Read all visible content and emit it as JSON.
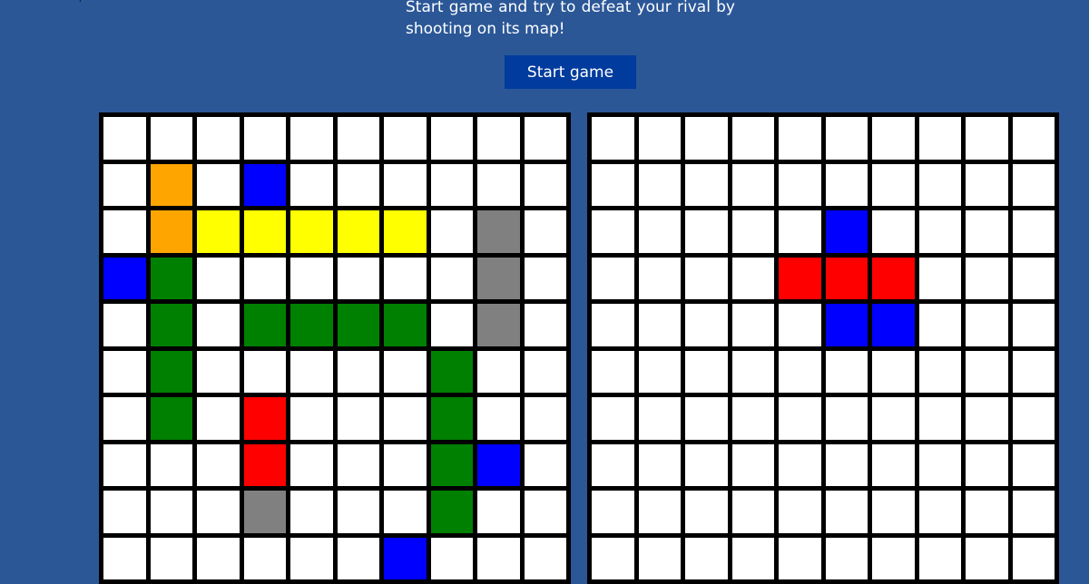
{
  "intro": {
    "text": "Start game and try to defeat your rival by shooting on its map!"
  },
  "start_button": {
    "label": "Start game"
  },
  "colors": {
    "page_background": "#2b5797",
    "button_background": "#003b9d",
    "grid_line": "#000000",
    "empty": "#ffffff",
    "orange": "#ffa500",
    "blue": "#0000ff",
    "yellow": "#ffff00",
    "gray": "#808080",
    "green": "#008000",
    "red": "#ff0000"
  },
  "boards": {
    "player": {
      "size": 10,
      "cells": [
        [
          "empty",
          "empty",
          "empty",
          "empty",
          "empty",
          "empty",
          "empty",
          "empty",
          "empty",
          "empty"
        ],
        [
          "empty",
          "orange",
          "empty",
          "blue",
          "empty",
          "empty",
          "empty",
          "empty",
          "empty",
          "empty"
        ],
        [
          "empty",
          "orange",
          "yellow",
          "yellow",
          "yellow",
          "yellow",
          "yellow",
          "empty",
          "gray",
          "empty"
        ],
        [
          "blue",
          "green",
          "empty",
          "empty",
          "empty",
          "empty",
          "empty",
          "empty",
          "gray",
          "empty"
        ],
        [
          "empty",
          "green",
          "empty",
          "green",
          "green",
          "green",
          "green",
          "empty",
          "gray",
          "empty"
        ],
        [
          "empty",
          "green",
          "empty",
          "empty",
          "empty",
          "empty",
          "empty",
          "green",
          "empty",
          "empty"
        ],
        [
          "empty",
          "green",
          "empty",
          "red",
          "empty",
          "empty",
          "empty",
          "green",
          "empty",
          "empty"
        ],
        [
          "empty",
          "empty",
          "empty",
          "red",
          "empty",
          "empty",
          "empty",
          "green",
          "blue",
          "empty"
        ],
        [
          "empty",
          "empty",
          "empty",
          "gray",
          "empty",
          "empty",
          "empty",
          "green",
          "empty",
          "empty"
        ],
        [
          "empty",
          "empty",
          "empty",
          "empty",
          "empty",
          "empty",
          "blue",
          "empty",
          "empty",
          "empty"
        ]
      ]
    },
    "rival": {
      "size": 10,
      "cells": [
        [
          "empty",
          "empty",
          "empty",
          "empty",
          "empty",
          "empty",
          "empty",
          "empty",
          "empty",
          "empty"
        ],
        [
          "empty",
          "empty",
          "empty",
          "empty",
          "empty",
          "empty",
          "empty",
          "empty",
          "empty",
          "empty"
        ],
        [
          "empty",
          "empty",
          "empty",
          "empty",
          "empty",
          "blue",
          "empty",
          "empty",
          "empty",
          "empty"
        ],
        [
          "empty",
          "empty",
          "empty",
          "empty",
          "red",
          "red",
          "red",
          "empty",
          "empty",
          "empty"
        ],
        [
          "empty",
          "empty",
          "empty",
          "empty",
          "empty",
          "blue",
          "blue",
          "empty",
          "empty",
          "empty"
        ],
        [
          "empty",
          "empty",
          "empty",
          "empty",
          "empty",
          "empty",
          "empty",
          "empty",
          "empty",
          "empty"
        ],
        [
          "empty",
          "empty",
          "empty",
          "empty",
          "empty",
          "empty",
          "empty",
          "empty",
          "empty",
          "empty"
        ],
        [
          "empty",
          "empty",
          "empty",
          "empty",
          "empty",
          "empty",
          "empty",
          "empty",
          "empty",
          "empty"
        ],
        [
          "empty",
          "empty",
          "empty",
          "empty",
          "empty",
          "empty",
          "empty",
          "empty",
          "empty",
          "empty"
        ],
        [
          "empty",
          "empty",
          "empty",
          "empty",
          "empty",
          "empty",
          "empty",
          "empty",
          "empty",
          "empty"
        ]
      ]
    }
  }
}
